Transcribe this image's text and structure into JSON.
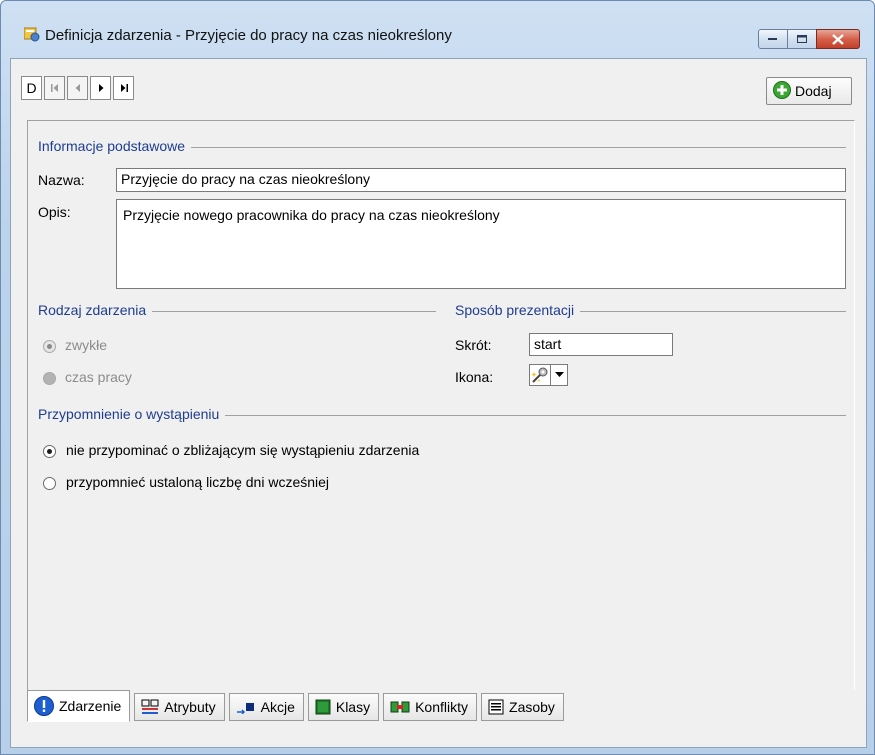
{
  "window": {
    "title": "Definicja zdarzenia - Przyjęcie do pracy na czas nieokreślony"
  },
  "toolbar": {
    "nav_new_label": "D",
    "add_label": "Dodaj"
  },
  "basic_info": {
    "heading": "Informacje podstawowe",
    "name_label": "Nazwa:",
    "name_value": "Przyjęcie do pracy na czas nieokreślony",
    "description_label": "Opis:",
    "description_value": "Przyjęcie nowego pracownika do pracy na czas nieokreślony"
  },
  "event_type": {
    "heading": "Rodzaj zdarzenia",
    "options": [
      {
        "label": "zwykłe",
        "selected": true
      },
      {
        "label": "czas pracy",
        "selected": false
      }
    ]
  },
  "presentation": {
    "heading": "Sposób prezentacji",
    "shortcut_label": "Skrót:",
    "shortcut_value": "start",
    "icon_label": "Ikona:",
    "icon_name": "magic-wand-gear-icon"
  },
  "reminder": {
    "heading": "Przypomnienie o wystąpieniu",
    "options": [
      {
        "label": "nie przypominać o zbliżającym się wystąpieniu zdarzenia",
        "selected": true
      },
      {
        "label": "przypomnieć ustaloną liczbę dni wcześniej",
        "selected": false
      }
    ]
  },
  "tabs": [
    {
      "label": "Zdarzenie",
      "icon": "info-icon",
      "active": true
    },
    {
      "label": "Atrybuty",
      "icon": "attributes-icon",
      "active": false
    },
    {
      "label": "Akcje",
      "icon": "action-arrow-icon",
      "active": false
    },
    {
      "label": "Klasy",
      "icon": "class-square-icon",
      "active": false
    },
    {
      "label": "Konflikty",
      "icon": "conflict-icon",
      "active": false
    },
    {
      "label": "Zasoby",
      "icon": "resources-list-icon",
      "active": false
    }
  ],
  "colors": {
    "section_heading": "#1e3d8f",
    "add_icon_green": "#3aa830",
    "info_icon_blue": "#1d5fd1"
  }
}
